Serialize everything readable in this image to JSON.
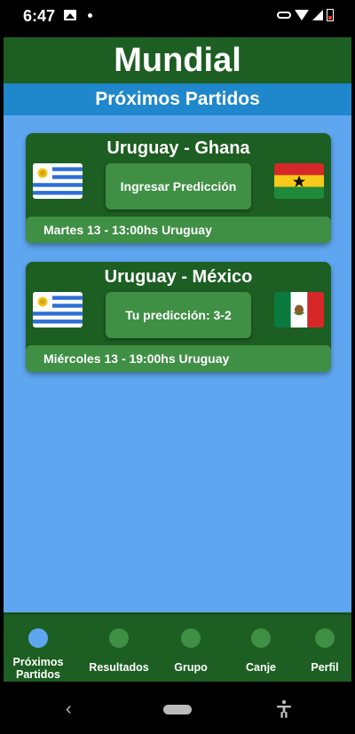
{
  "status_bar": {
    "time": "6:47"
  },
  "app": {
    "title": "Mundial",
    "subtitle": "Próximos Partidos"
  },
  "matches": [
    {
      "title": "Uruguay - Ghana",
      "home_flag": "uruguay-flag",
      "away_flag": "ghana-flag",
      "action_label": "Ingresar Predicción",
      "date": "Martes 13 - 13:00hs Uruguay"
    },
    {
      "title": "Uruguay - México",
      "home_flag": "uruguay-flag",
      "away_flag": "mexico-flag",
      "action_label": "Tu predicción: 3-2",
      "date": "Miércoles 13 - 19:00hs Uruguay"
    }
  ],
  "bottom_nav": {
    "items": [
      {
        "label_line1": "Próximos",
        "label_line2": "Partidos",
        "active": true
      },
      {
        "label": "Resultados",
        "active": false
      },
      {
        "label": "Grupo",
        "active": false
      },
      {
        "label": "Canje",
        "active": false
      },
      {
        "label": "Perfil",
        "active": false
      }
    ]
  },
  "colors": {
    "header_green": "#1d5e22",
    "accent_green": "#3f8f45",
    "subheader_blue": "#1f87cc",
    "background_blue": "#5ea6f0"
  }
}
